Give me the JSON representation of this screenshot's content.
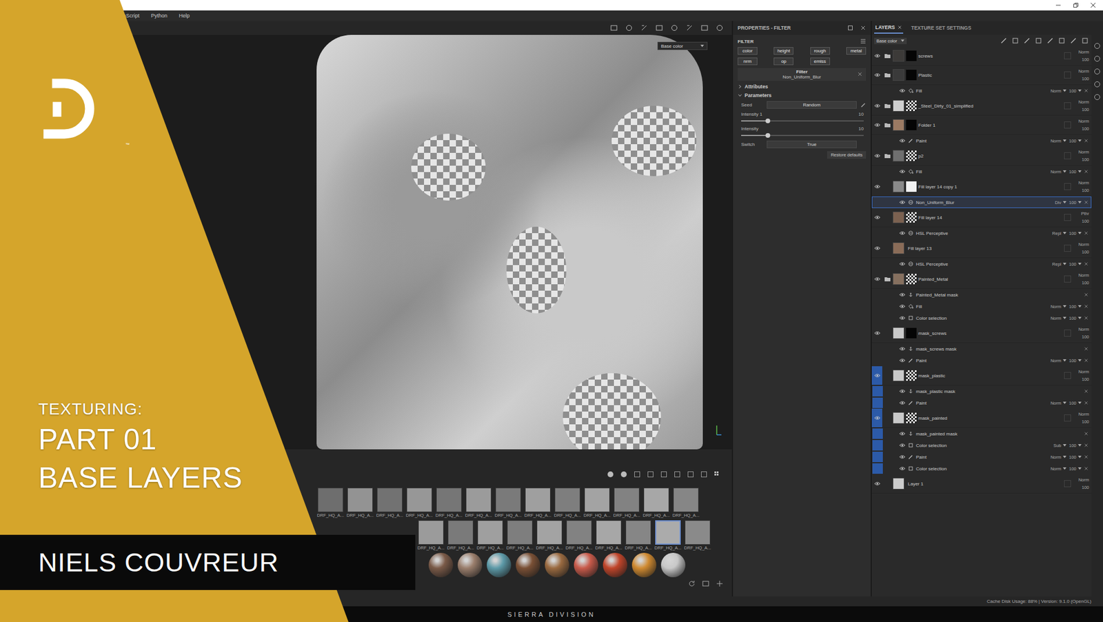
{
  "overlay": {
    "logo_mark": "™",
    "kicker": "TEXTURING:",
    "title_lines": [
      "PART 01",
      "BASE LAYERS"
    ],
    "author": "NIELS COUVREUR"
  },
  "menu": [
    "aScript",
    "Python",
    "Help"
  ],
  "viewport": {
    "channel": "Base color"
  },
  "properties": {
    "title": "PROPERTIES - FILTER",
    "section": "FILTER",
    "channels": [
      {
        "label": "color",
        "on": true
      },
      {
        "label": "height",
        "on": true
      },
      {
        "label": "rough",
        "on": true
      },
      {
        "label": "metal",
        "on": true
      },
      {
        "label": "nrm",
        "on": true
      },
      {
        "label": "op",
        "on": true
      },
      {
        "label": "emiss",
        "on": true
      }
    ],
    "filter": {
      "label": "Filter",
      "name": "Non_Uniform_Blur"
    },
    "groups": [
      {
        "label": "Attributes",
        "expanded": false
      },
      {
        "label": "Parameters",
        "expanded": true
      }
    ],
    "params": [
      {
        "kind": "field",
        "label": "Seed",
        "value": "Random"
      },
      {
        "kind": "slider",
        "label": "Intensity 1",
        "value": "10",
        "level": 0.22
      },
      {
        "kind": "slider",
        "label": "Intensity",
        "value": "10",
        "level": 0.22
      },
      {
        "kind": "field",
        "label": "Switch",
        "value": "True"
      }
    ],
    "restore": "Restore defaults"
  },
  "layers_panel": {
    "tabs": [
      {
        "label": "LAYERS",
        "selected": true,
        "closable": true
      },
      {
        "label": "TEXTURE SET SETTINGS",
        "selected": false,
        "closable": false
      }
    ],
    "channel": "Base color",
    "layers": [
      {
        "name": "screws",
        "kind": "folder",
        "blend": "Norm",
        "opacity": "100",
        "color": "#3c3a38",
        "mask": "black",
        "marked": false,
        "visible": true,
        "children": []
      },
      {
        "name": "Plastic",
        "kind": "folder",
        "blend": "Norm",
        "opacity": "100",
        "color": "#3a3a3a",
        "mask": "black",
        "marked": false,
        "visible": true,
        "children": [
          {
            "name": "Fill",
            "kind": "fill",
            "blend": "Norm",
            "opacity": "100",
            "visible": true,
            "selected": false
          }
        ]
      },
      {
        "name": "_Steel_Dirty_01_simplified",
        "kind": "folder",
        "blend": "Norm",
        "opacity": "100",
        "color": "#cfcfcf",
        "mask": "noise",
        "marked": false,
        "visible": true,
        "children": []
      },
      {
        "name": "Folder 1",
        "kind": "folder",
        "blend": "Norm",
        "opacity": "100",
        "color": "#9b7a63",
        "mask": "black",
        "marked": false,
        "visible": true,
        "children": [
          {
            "name": "Paint",
            "kind": "paint",
            "blend": "Norm",
            "opacity": "100",
            "visible": true,
            "selected": false
          }
        ]
      },
      {
        "name": "p2",
        "kind": "folder",
        "blend": "Norm",
        "opacity": "100",
        "color": "#6f6f6f",
        "mask": "noise",
        "marked": false,
        "visible": true,
        "children": [
          {
            "name": "Fill",
            "kind": "fill",
            "blend": "Norm",
            "opacity": "100",
            "visible": true,
            "selected": false
          }
        ]
      },
      {
        "name": "Fill layer 14 copy 1",
        "kind": "layer",
        "blend": "Norm",
        "opacity": "100",
        "color": "#8a8a8a",
        "mask": "white",
        "marked": false,
        "visible": true,
        "children": [
          {
            "name": "Non_Uniform_Blur",
            "kind": "filter",
            "blend": "Div",
            "opacity": "100",
            "visible": true,
            "selected": true
          }
        ]
      },
      {
        "name": "Fill layer 14",
        "kind": "layer",
        "blend": "Pthr",
        "opacity": "100",
        "color": "#7b6150",
        "mask": "noise",
        "marked": false,
        "visible": true,
        "children": [
          {
            "name": "HSL Perceptive",
            "kind": "filter",
            "blend": "Repl",
            "opacity": "100",
            "visible": true,
            "selected": false
          }
        ]
      },
      {
        "name": "Fill layer 13",
        "kind": "layer",
        "blend": "Norm",
        "opacity": "100",
        "color": "#8a6c58",
        "mask": "none",
        "marked": false,
        "visible": true,
        "children": [
          {
            "name": "HSL Perceptive",
            "kind": "filter",
            "blend": "Repl",
            "opacity": "100",
            "visible": true,
            "selected": false
          }
        ]
      },
      {
        "name": "Painted_Metal",
        "kind": "folder",
        "blend": "Norm",
        "opacity": "100",
        "color": "#86705f",
        "mask": "noise",
        "marked": false,
        "visible": true,
        "children": [
          {
            "name": "Painted_Metal mask",
            "kind": "mask",
            "visible": true,
            "selected": false
          },
          {
            "name": "Fill",
            "kind": "fill",
            "blend": "Norm",
            "opacity": "100",
            "visible": true,
            "selected": false
          },
          {
            "name": "Color selection",
            "kind": "selection",
            "blend": "Norm",
            "opacity": "100",
            "visible": true,
            "selected": false
          }
        ]
      },
      {
        "name": "mask_screws",
        "kind": "layer",
        "blend": "Norm",
        "opacity": "100",
        "color": "#c9c9c9",
        "mask": "black",
        "marked": false,
        "visible": true,
        "children": [
          {
            "name": "mask_screws mask",
            "kind": "mask",
            "visible": true,
            "selected": false
          },
          {
            "name": "Paint",
            "kind": "paint",
            "blend": "Norm",
            "opacity": "100",
            "visible": true,
            "selected": false
          }
        ]
      },
      {
        "name": "mask_plastic",
        "kind": "layer",
        "blend": "Norm",
        "opacity": "100",
        "color": "#c9c9c9",
        "mask": "noise",
        "marked": true,
        "visible": true,
        "children": [
          {
            "name": "mask_plastic mask",
            "kind": "mask",
            "visible": true,
            "selected": false
          },
          {
            "name": "Paint",
            "kind": "paint",
            "blend": "Norm",
            "opacity": "100",
            "visible": true,
            "selected": false
          }
        ]
      },
      {
        "name": "mask_painted",
        "kind": "layer",
        "blend": "Norm",
        "opacity": "100",
        "color": "#c9c9c9",
        "mask": "noise",
        "marked": true,
        "visible": true,
        "children": [
          {
            "name": "mask_painted mask",
            "kind": "mask",
            "visible": true,
            "selected": false
          },
          {
            "name": "Color selection",
            "kind": "selection",
            "blend": "Sub",
            "opacity": "100",
            "visible": true,
            "selected": false
          },
          {
            "name": "Paint",
            "kind": "paint",
            "blend": "Norm",
            "opacity": "100",
            "visible": true,
            "selected": false
          },
          {
            "name": "Color selection",
            "kind": "selection",
            "blend": "Norm",
            "opacity": "100",
            "visible": true,
            "selected": false
          }
        ]
      },
      {
        "name": "Layer 1",
        "kind": "layer",
        "blend": "Norm",
        "opacity": "100",
        "color": "#cccccc",
        "mask": "none",
        "marked": false,
        "visible": true,
        "children": []
      }
    ]
  },
  "shelf": {
    "textures": [
      [
        {
          "label": "DRF_HQ_A...",
          "selected": false
        },
        {
          "label": "DRF_HQ_A...",
          "selected": false
        },
        {
          "label": "DRF_HQ_A...",
          "selected": false
        },
        {
          "label": "DRF_HQ_A...",
          "selected": false
        },
        {
          "label": "DRF_HQ_A...",
          "selected": false
        },
        {
          "label": "DRF_HQ_A...",
          "selected": false
        },
        {
          "label": "DRF_HQ_A...",
          "selected": false
        },
        {
          "label": "DRF_HQ_A...",
          "selected": false
        },
        {
          "label": "DRF_HQ_A...",
          "selected": false
        },
        {
          "label": "DRF_HQ_A...",
          "selected": false
        },
        {
          "label": "DRF_HQ_A...",
          "selected": false
        },
        {
          "label": "DRF_HQ_A...",
          "selected": false
        },
        {
          "label": "DRF_HQ_A...",
          "selected": false
        }
      ],
      [
        {
          "label": "DRF_HQ_A...",
          "selected": false
        },
        {
          "label": "DRF_HQ_A...",
          "selected": false
        },
        {
          "label": "DRF_HQ_A...",
          "selected": false
        },
        {
          "label": "DRF_HQ_A...",
          "selected": false
        },
        {
          "label": "DRF_HQ_A...",
          "selected": false
        },
        {
          "label": "DRF_HQ_A...",
          "selected": false
        },
        {
          "label": "DRF_HQ_A...",
          "selected": false
        },
        {
          "label": "DRF_HQ_A...",
          "selected": false
        },
        {
          "label": "DRF_HQ_A...",
          "selected": true
        },
        {
          "label": "DRF_HQ_A...",
          "selected": false
        }
      ]
    ],
    "materials": [
      {
        "color": "#7a5a48"
      },
      {
        "color": "#9a7e6c"
      },
      {
        "color": "#5d9aa8"
      },
      {
        "color": "#7a5035"
      },
      {
        "color": "#9a6a40"
      },
      {
        "color": "#c85a4a"
      },
      {
        "color": "#c0452a"
      },
      {
        "color": "#d08a30"
      },
      {
        "color": "#c8c8c8"
      }
    ]
  },
  "status": {
    "text": "Cache Disk Usage:  88% | Version: 9.1.0 (OpenGL)"
  },
  "footer": "SIERRA DIVISION"
}
